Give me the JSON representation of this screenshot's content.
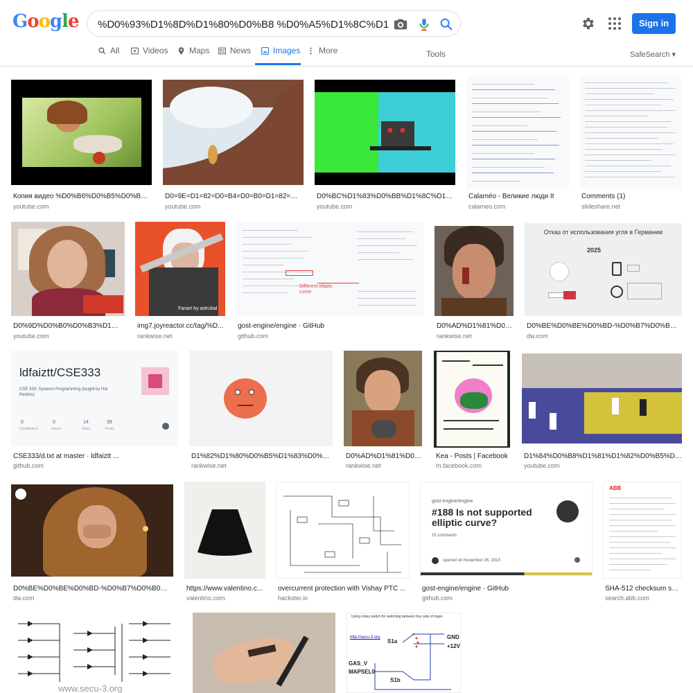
{
  "search": {
    "query": "%D0%93%D1%8D%D1%80%D0%B8 %D0%A5%D1%8C%D1%8E%D0%B",
    "tabs": [
      {
        "label": "All",
        "icon": "search-icon"
      },
      {
        "label": "Videos",
        "icon": "video-icon"
      },
      {
        "label": "Maps",
        "icon": "map-pin-icon"
      },
      {
        "label": "News",
        "icon": "news-icon"
      },
      {
        "label": "Images",
        "icon": "image-icon",
        "active": true
      },
      {
        "label": "More",
        "icon": "more-vert-icon"
      }
    ],
    "tools_label": "Tools",
    "safesearch_label": "SafeSearch ▾"
  },
  "header": {
    "signin_label": "Sign in"
  },
  "colors": {
    "accent": "#1a73e8",
    "text": "#202124",
    "muted": "#70757a",
    "border": "#dadce0"
  },
  "results": [
    {
      "caption": "Копия видео %D0%B6%D0%B5%D0%BD%D...",
      "source": "youtube.com"
    },
    {
      "caption": "D0=9E=D1=82=D0=B4=D0=B0=D1=82=D1=8...",
      "source": "youtube.com"
    },
    {
      "caption": "D0%BC%D1%83%D0%BB%D1%8C%D1%82%...",
      "source": "youtube.com"
    },
    {
      "caption": "Calaméo - Великие люди It",
      "source": "calameo.com"
    },
    {
      "caption": "Comments (1)",
      "source": "slideshare.net"
    },
    {
      "caption": "D0%9D%D0%B0%D0%B3%D1%80%...",
      "source": "youtube.com"
    },
    {
      "caption": "img7.joyreactor.cc/tag/%D...",
      "source": "rankwise.net"
    },
    {
      "caption": "gost-engine/engine · GitHub",
      "source": "github.com"
    },
    {
      "caption": "D0%AD%D1%81%D0%B...",
      "source": "rankwise.net"
    },
    {
      "caption": "D0%BE%D0%BE%D0%BD-%D0%B7%D0%B0%D1%8...",
      "source": "dw.com"
    },
    {
      "caption": "CSE333/d.txt at master · ldfaiztt ...",
      "source": "github.com"
    },
    {
      "caption": "D1%82%D1%80%D0%B5%D1%83%D0%B3%D...",
      "source": "rankwise.net"
    },
    {
      "caption": "D0%AD%D1%81%D0%B...",
      "source": "rankwise.net"
    },
    {
      "caption": "Kea - Posts | Facebook",
      "source": "m.facebook.com"
    },
    {
      "caption": "D1%84%D0%B8%D1%81%D1%82%D0%B5%D0%B2...",
      "source": "youtube.com"
    },
    {
      "caption": "D0%BE%D0%BE%D0%BD-%D0%B7%D0%B0%D1%8F...",
      "source": "dw.com"
    },
    {
      "caption": "https://www.valentino.c...",
      "source": "valentino.com"
    },
    {
      "caption": "overcurrent protection with Vishay PTC ...",
      "source": "hackster.io"
    },
    {
      "caption": "gost-engine/engine · GitHub",
      "source": "github.com"
    },
    {
      "caption": "SHA-512 checksum su...",
      "source": "search.abb.com"
    },
    {
      "caption": "",
      "source": ""
    },
    {
      "caption": "",
      "source": ""
    },
    {
      "caption": "",
      "source": ""
    }
  ],
  "image_text": {
    "slide_title": "Отказ от использования угля в Германии",
    "slide_year": "2025",
    "repo_name": "ldfaiztt/CSE333",
    "repo_desc": "CSE 333: Systems Programming (taught by Hal Perkins)",
    "repo_stats": [
      "0",
      "0",
      "14",
      "39"
    ],
    "repo_stat_labels": [
      "Contributors",
      "Issues",
      "Stars",
      "Forks"
    ],
    "issue_repo": "gost-engine/engine",
    "issue_title": "#188 Is not supported elliptic curve?",
    "issue_comments": "15 comments",
    "issue_meta": "opened on November 26, 2019",
    "diagram_note": "Different elliptic curve",
    "watermark": "www.secu-3.org",
    "map_title": "Using rotary switch for switching between four sets of maps",
    "map_url": "http://secu-3.org",
    "map_labels": [
      "GND",
      "+12V",
      "GAS_V",
      "MAPSEL0",
      "S1a",
      "S1b"
    ],
    "abb": "ABB",
    "fanart": "Fanart by astrubal"
  }
}
